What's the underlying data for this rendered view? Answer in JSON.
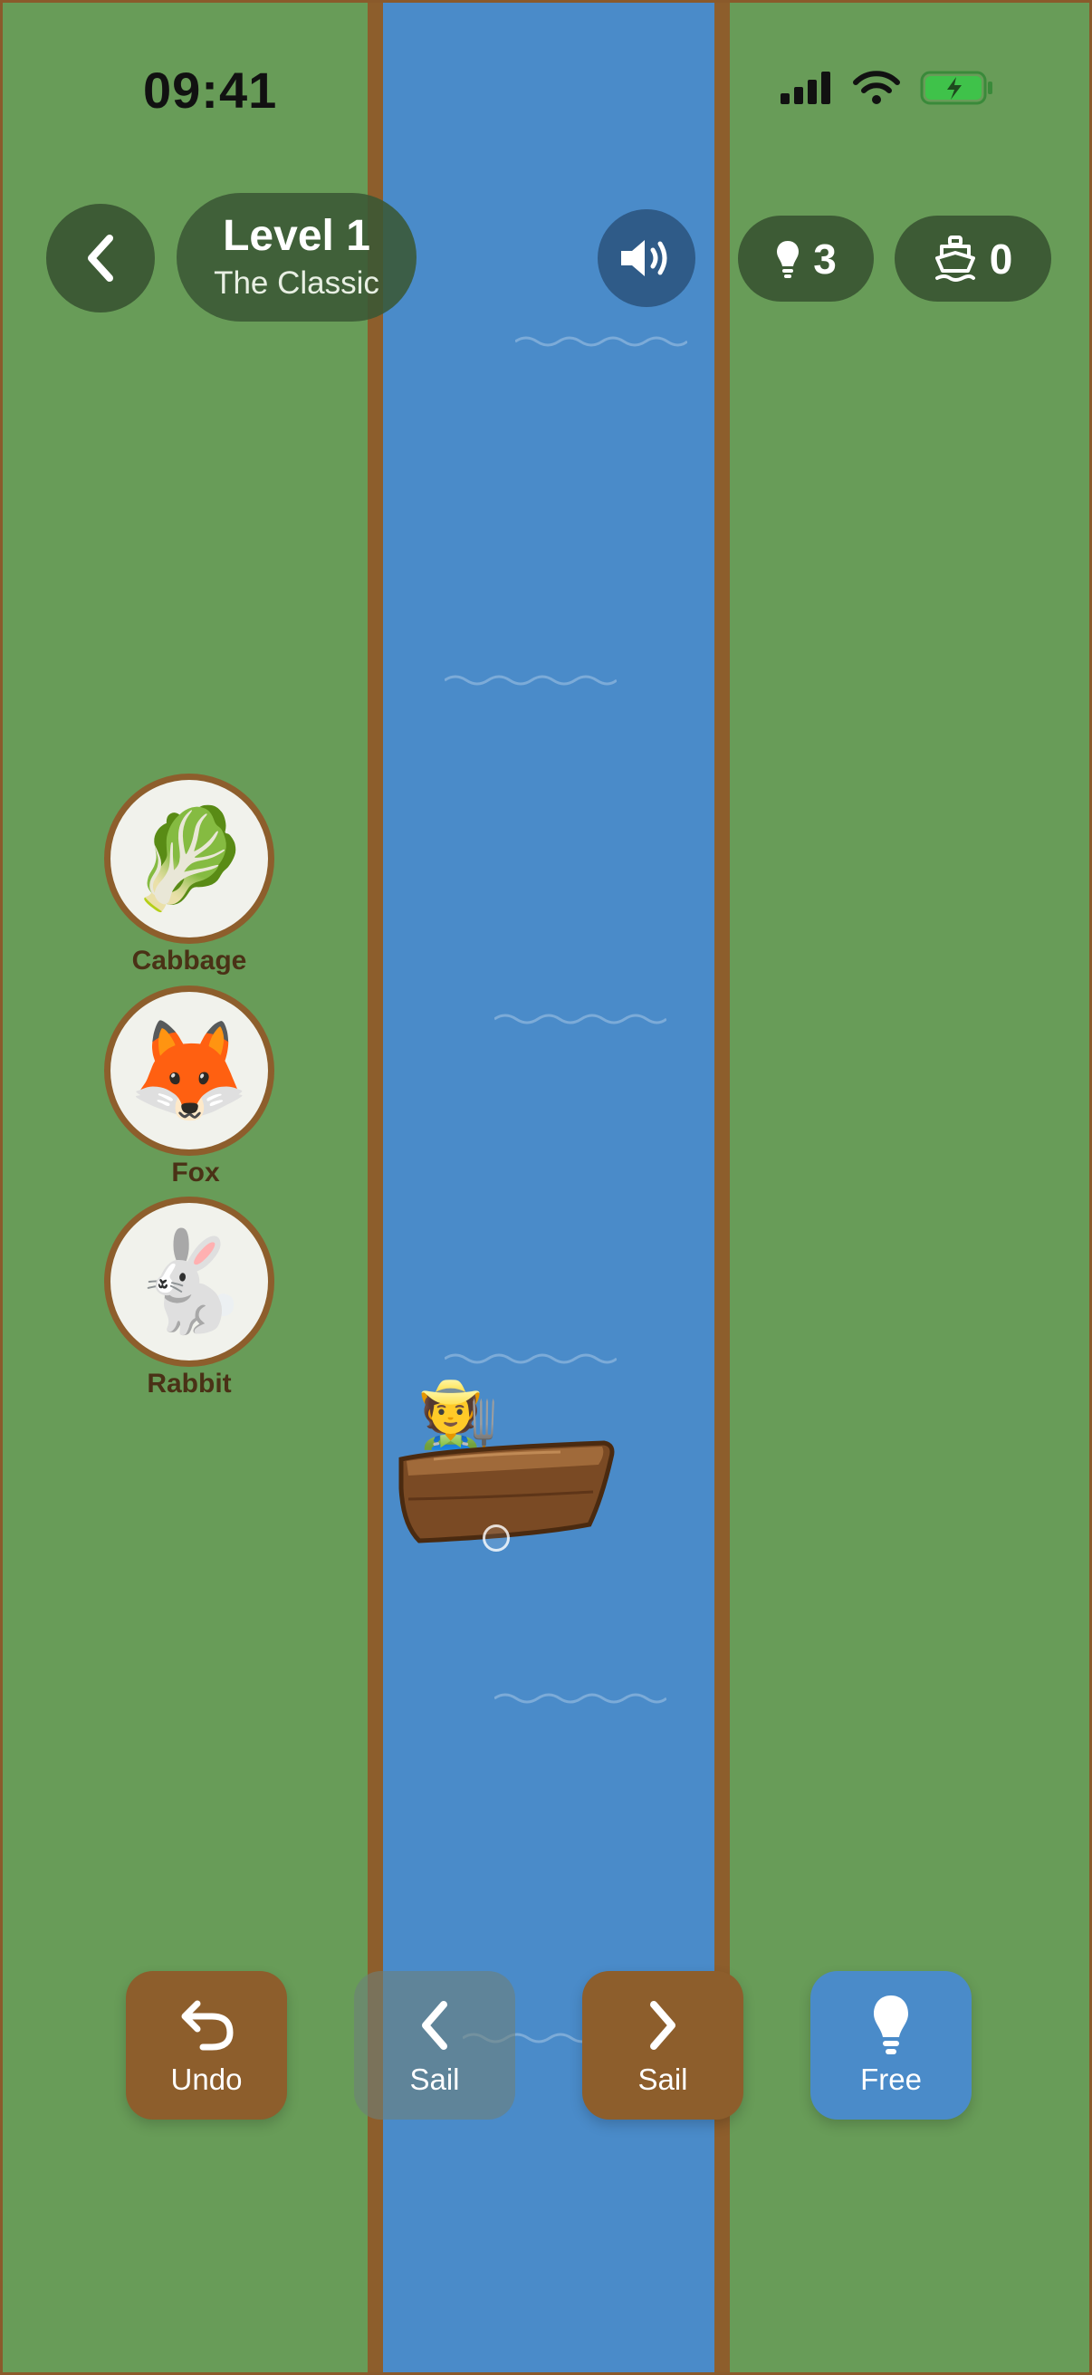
{
  "status_bar": {
    "time": "09:41"
  },
  "header": {
    "level_title": "Level 1",
    "level_subtitle": "The Classic",
    "hints_count": "3",
    "trips_count": "0"
  },
  "items": [
    {
      "label": "Cabbage",
      "emoji": "🥬"
    },
    {
      "label": "Fox",
      "emoji": "🦊"
    },
    {
      "label": "Rabbit",
      "emoji": "🐇"
    }
  ],
  "boat": {
    "passenger_emoji": "🧑‍🌾"
  },
  "controls": {
    "undo_label": "Undo",
    "sail_left_label": "Sail",
    "sail_right_label": "Sail",
    "free_label": "Free"
  },
  "colors": {
    "grass": "#689c58",
    "river": "#4a8bc9",
    "shore": "#8d5e2c",
    "pill": "#3d5b35",
    "sound": "#2f5b88"
  }
}
